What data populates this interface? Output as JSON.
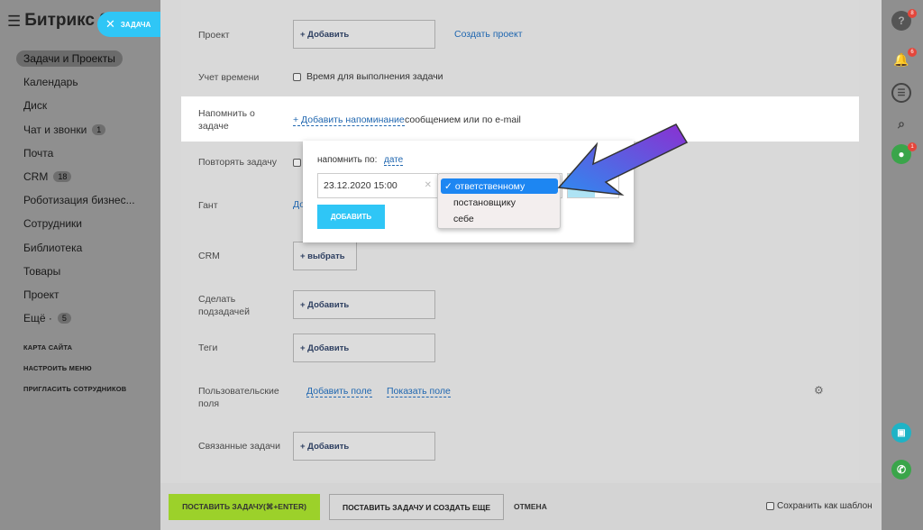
{
  "app": {
    "logo": "Битрикс 2",
    "task_tab": "ЗАДАЧА"
  },
  "sidebar": {
    "items": [
      {
        "label": "Задачи и Проекты",
        "badge": ""
      },
      {
        "label": "Календарь",
        "badge": ""
      },
      {
        "label": "Диск",
        "badge": ""
      },
      {
        "label": "Чат и звонки",
        "badge": "1"
      },
      {
        "label": "Почта",
        "badge": ""
      },
      {
        "label": "CRM",
        "badge": "18"
      },
      {
        "label": "Роботизация бизнес...",
        "badge": ""
      },
      {
        "label": "Сотрудники",
        "badge": ""
      },
      {
        "label": "Библиотека",
        "badge": ""
      },
      {
        "label": "Товары",
        "badge": ""
      },
      {
        "label": "Проект",
        "badge": ""
      },
      {
        "label": "Ещё ·",
        "badge": "5"
      }
    ],
    "sitemap": "КАРТА САЙТА",
    "configure": "НАСТРОИТЬ МЕНЮ",
    "invite": "ПРИГЛАСИТЬ СОТРУДНИКОВ"
  },
  "form": {
    "project_label": "Проект",
    "project_add": "+ Добавить",
    "project_create": "Создать проект",
    "time_label": "Учет времени",
    "time_checkbox": "Время для выполнения задачи",
    "remind_label_1": "Напомнить о",
    "remind_label_2": "задаче",
    "remind_link": "+ Добавить напоминание",
    "remind_tail": "сообщением или по e-mail",
    "repeat_label": "Повторять задачу",
    "gantt_label": "Гант",
    "gantt_link_partial": "До",
    "crm_label": "CRM",
    "crm_select": "+  выбрать",
    "subtask_label_1": "Сделать",
    "subtask_label_2": "подзадачей",
    "subtask_add": "+ Добавить",
    "tags_label": "Теги",
    "tags_add": "+ Добавить",
    "userfields_label_1": "Пользовательские",
    "userfields_label_2": "поля",
    "add_field": "Добавить поле",
    "show_field": "Показать поле",
    "related_label": "Связанные задачи",
    "related_add": "+ Добавить"
  },
  "popup": {
    "remind_by_label": "напомнить по:",
    "remind_by_value": "дате",
    "datetime": "23.12.2020 15:00",
    "add_button": "ДОБАВИТЬ",
    "options": [
      "ответственному",
      "постановщику",
      "себе"
    ],
    "selected_index": 0
  },
  "footer": {
    "submit": "ПОСТАВИТЬ ЗАДАЧУ(⌘+ENTER)",
    "submit_and_new": "ПОСТАВИТЬ ЗАДАЧУ И СОЗДАТЬ ЕЩЕ",
    "cancel": "ОТМЕНА",
    "save_template": "Сохранить как шаблон"
  },
  "rightbar": {
    "help_badge": "8",
    "notify_badge": "6",
    "user_badge": "1"
  },
  "colors": {
    "accent": "#2fc6f6",
    "submit_green": "#9cd12a",
    "link": "#2067b0",
    "dropdown_selected": "#1d86f2",
    "arrow": "#7a3cd8"
  }
}
